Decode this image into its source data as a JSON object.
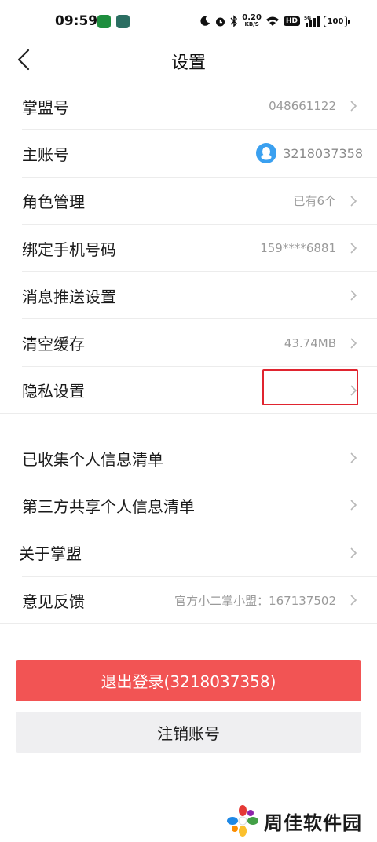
{
  "status_bar": {
    "time": "09:59",
    "speed_value": "0.20",
    "speed_unit": "KB/S",
    "hd": "HD",
    "net": "5G",
    "battery": "100"
  },
  "nav": {
    "title": "设置"
  },
  "section1": [
    {
      "label": "掌盟号",
      "value": "048661122"
    },
    {
      "label": "主账号",
      "value": "3218037358"
    },
    {
      "label": "角色管理",
      "value": "已有6个"
    },
    {
      "label": "绑定手机号码",
      "value": "159****6881"
    },
    {
      "label": "消息推送设置",
      "value": ""
    },
    {
      "label": "清空缓存",
      "value": "43.74MB"
    },
    {
      "label": "隐私设置",
      "value": ""
    }
  ],
  "section2": [
    {
      "label": "已收集个人信息清单",
      "value": ""
    },
    {
      "label": "第三方共享个人信息清单",
      "value": ""
    },
    {
      "label": "关于掌盟",
      "value": ""
    },
    {
      "label": "意见反馈",
      "value": "官方小二掌小盟：167137502"
    }
  ],
  "buttons": {
    "logout": "退出登录(3218037358)",
    "cancel_account": "注销账号"
  },
  "watermark": {
    "text": "周佳软件园"
  },
  "colors": {
    "logout_bg": "#f25454",
    "highlight": "#e0242f",
    "qq_blue": "#3aa0f0"
  }
}
